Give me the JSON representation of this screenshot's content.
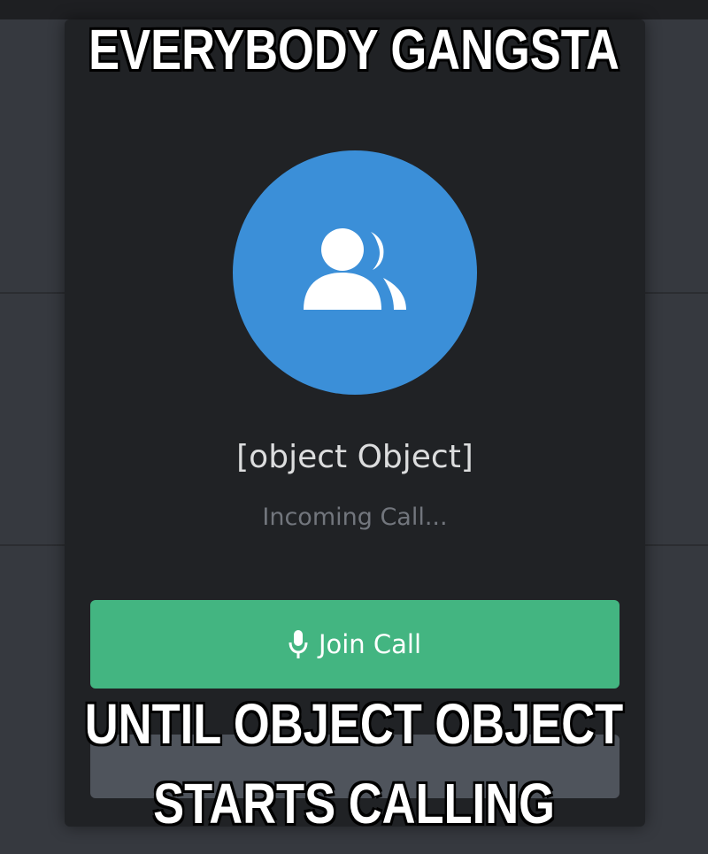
{
  "meme": {
    "top_text": "EVERYBODY GANGSTA",
    "bottom_line1": "UNTIL OBJECT OBJECT",
    "bottom_line2": "STARTS CALLING"
  },
  "call_modal": {
    "caller_name": "[object Object]",
    "status": "Incoming Call...",
    "join_button_label": "Join Call",
    "avatar_icon": "group-users-icon",
    "join_icon": "microphone-icon"
  },
  "colors": {
    "background": "#36393f",
    "modal": "#202225",
    "avatar": "#3b8fd8",
    "join_button": "#43b581",
    "decline_button": "#4f545c"
  }
}
